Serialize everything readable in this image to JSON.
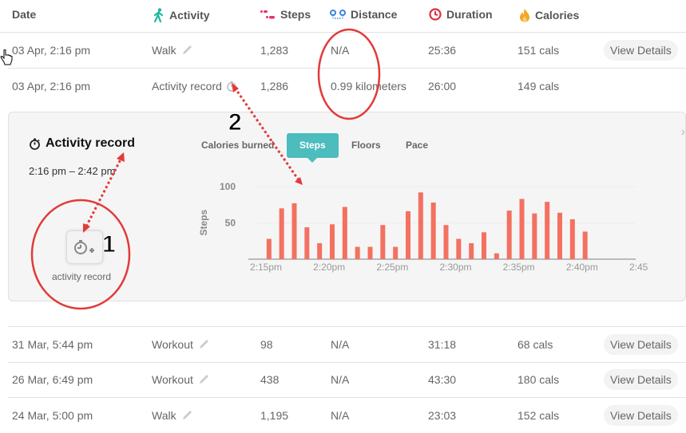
{
  "header": {
    "date": "Date",
    "activity": "Activity",
    "steps": "Steps",
    "distance": "Distance",
    "duration": "Duration",
    "calories": "Calories",
    "icons": {
      "activity": "walking-person-icon",
      "steps": "footprints-icon",
      "distance": "route-pins-icon",
      "duration": "clock-icon",
      "calories": "flame-icon"
    },
    "colors": {
      "activity": "#1cb8a1",
      "steps": "#e5336b",
      "distance": "#3b82e0",
      "duration": "#d9313c",
      "calories": "#f5a623"
    }
  },
  "rows_top": [
    {
      "date": "03 Apr, 2:16 pm",
      "activity": "Walk",
      "activity_icon": "pencil-icon",
      "steps": "1,283",
      "distance": "N/A",
      "duration": "25:36",
      "calories": "151 cals",
      "action": "View Details"
    },
    {
      "date": "03 Apr, 2:16 pm",
      "activity": "Activity record",
      "activity_icon": "stopwatch-icon",
      "steps": "1,286",
      "distance": "0.99 kilometers",
      "duration": "26:00",
      "calories": "149 cals",
      "action": ""
    }
  ],
  "detail": {
    "title": "Activity record",
    "time_range": "2:16 pm – 2:42 pm",
    "record_button_label": "activity record",
    "tabs": [
      "Calories burned",
      "Steps",
      "Floors",
      "Pace"
    ],
    "active_tab": "Steps",
    "accent": "#4cbcbd"
  },
  "chart_data": {
    "type": "bar",
    "title": "",
    "xlabel": "",
    "ylabel": "Steps",
    "ylim": [
      0,
      110
    ],
    "yticks": [
      50,
      100
    ],
    "xtick_labels": [
      "2:15pm",
      "2:20pm",
      "2:25pm",
      "2:30pm",
      "2:35pm",
      "2:40pm",
      "2:45pm"
    ],
    "x_minutes_from_215": [
      1,
      2,
      3,
      4,
      5,
      6,
      7,
      8,
      9,
      10,
      11,
      12,
      13,
      14,
      15,
      16,
      17,
      18,
      19,
      20,
      21,
      22,
      23,
      24,
      25,
      26,
      27
    ],
    "values": [
      28,
      70,
      77,
      44,
      22,
      48,
      72,
      17,
      17,
      47,
      17,
      66,
      92,
      78,
      47,
      28,
      22,
      37,
      8,
      67,
      83,
      63,
      79,
      64,
      55,
      38
    ],
    "bar_color": "#f47060",
    "grid": true
  },
  "rows_bottom": [
    {
      "date": "31 Mar, 5:44 pm",
      "activity": "Workout",
      "activity_icon": "pencil-icon",
      "steps": "98",
      "distance": "N/A",
      "duration": "31:18",
      "calories": "68 cals",
      "action": "View Details"
    },
    {
      "date": "26 Mar, 6:49 pm",
      "activity": "Workout",
      "activity_icon": "pencil-icon",
      "steps": "438",
      "distance": "N/A",
      "duration": "43:30",
      "calories": "180 cals",
      "action": "View Details"
    },
    {
      "date": "24 Mar, 5:00 pm",
      "activity": "Walk",
      "activity_icon": "pencil-icon",
      "steps": "1,195",
      "distance": "N/A",
      "duration": "23:03",
      "calories": "152 cals",
      "action": "View Details"
    }
  ],
  "annotations": {
    "label_1": "1",
    "label_2": "2"
  }
}
